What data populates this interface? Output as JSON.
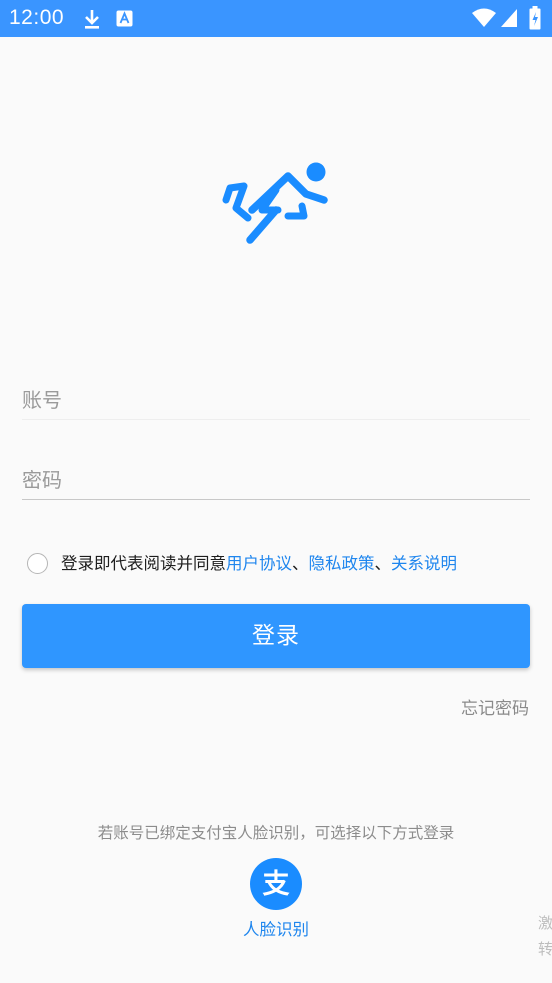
{
  "status_bar": {
    "time": "12:00",
    "icons": [
      "download-icon",
      "font-notification-icon",
      "wifi-icon",
      "signal-icon",
      "battery-icon"
    ]
  },
  "logo": {
    "name": "running-person-logo",
    "color": "#1a8cff"
  },
  "form": {
    "account_placeholder": "账号",
    "password_placeholder": "密码"
  },
  "agreement": {
    "prefix": "登录即代表阅读并同意",
    "user_agreement": "用户协议",
    "sep1": "、",
    "privacy_policy": "隐私政策",
    "sep2": "、",
    "relationship_note": "关系说明"
  },
  "login_button": {
    "label": "登录"
  },
  "forgot_password": "忘记密码",
  "alternate_login": {
    "hint": "若账号已绑定支付宝人脸识别，可选择以下方式登录",
    "alipay_icon_char": "支",
    "label": "人脸识别"
  },
  "corner_overlay": {
    "line1": "激",
    "line2": "转"
  },
  "colors": {
    "status_bar": "#3a95ff",
    "primary": "#2f96ff",
    "link": "#1f86ee",
    "background": "#fafafa"
  }
}
